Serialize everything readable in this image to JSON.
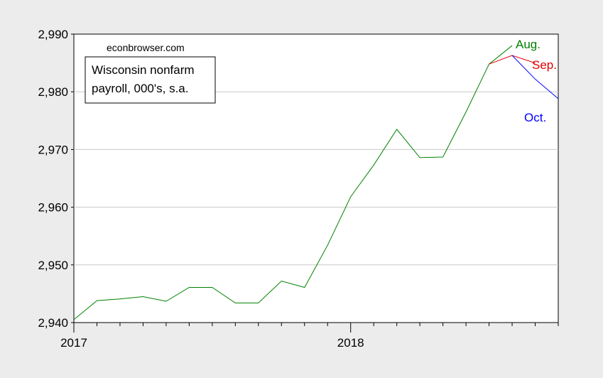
{
  "chart_data": {
    "type": "line",
    "source_note": "econbrowser.com",
    "annotation_box": [
      "Wisconsin nonfarm",
      "payroll, 000's, s.a."
    ],
    "ylim": [
      2940,
      2990
    ],
    "yticks": [
      2940,
      2950,
      2960,
      2970,
      2980,
      2990
    ],
    "ytick_labels": [
      "2,940",
      "2,950",
      "2,960",
      "2,970",
      "2,980",
      "2,990"
    ],
    "x_range": [
      "2017-01",
      "2018-10"
    ],
    "xticks": [
      {
        "date": "2017-01",
        "label": "2017"
      },
      {
        "date": "2018-01",
        "label": "2018"
      }
    ],
    "grid": "horizontal",
    "series": [
      {
        "name": "Aug.",
        "color": "#008000",
        "x": [
          "2017-01",
          "2017-02",
          "2017-03",
          "2017-04",
          "2017-05",
          "2017-06",
          "2017-07",
          "2017-08",
          "2017-09",
          "2017-10",
          "2017-11",
          "2017-12",
          "2018-01",
          "2018-02",
          "2018-03",
          "2018-04",
          "2018-05",
          "2018-06",
          "2018-07",
          "2018-08"
        ],
        "values": [
          2940.5,
          2943.8,
          2944.1,
          2944.5,
          2943.7,
          2946.1,
          2946.1,
          2943.4,
          2943.4,
          2947.2,
          2946.1,
          2953.4,
          2961.8,
          2967.3,
          2973.5,
          2968.6,
          2968.7,
          2976.5,
          2984.8,
          2988.0
        ]
      },
      {
        "name": "Sep.",
        "color": "#e00000",
        "x": [
          "2018-07",
          "2018-08",
          "2018-09"
        ],
        "values": [
          2984.8,
          2986.3,
          2985.0
        ]
      },
      {
        "name": "Oct.",
        "color": "#0000ff",
        "x": [
          "2018-08",
          "2018-09",
          "2018-10"
        ],
        "values": [
          2986.3,
          2982.2,
          2978.8
        ]
      }
    ]
  }
}
